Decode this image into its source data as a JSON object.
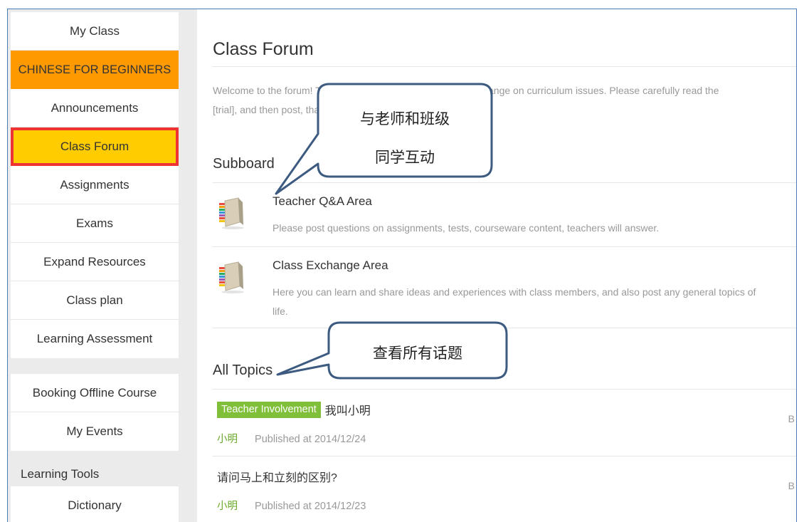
{
  "sidebar": {
    "group1": [
      {
        "label": "My Class"
      },
      {
        "label": "CHINESE FOR BEGINNERS"
      },
      {
        "label": "Announcements"
      },
      {
        "label": "Class Forum"
      },
      {
        "label": "Assignments"
      },
      {
        "label": "Exams"
      },
      {
        "label": "Expand Resources"
      },
      {
        "label": "Class plan"
      },
      {
        "label": "Learning Assessment"
      }
    ],
    "group2": [
      {
        "label": "Booking Offline Course"
      },
      {
        "label": "My Events"
      }
    ],
    "tools_label": "Learning Tools",
    "tools": [
      {
        "label": "Dictionary"
      }
    ]
  },
  "main": {
    "title": "Class Forum",
    "welcome_line1": "Welcome to the forum! The forum is used for everyone to exchange on curriculum issues. Please carefully read the",
    "welcome_line2": "[trial], and then post, thank you!",
    "subboard_title": "Subboard",
    "boards": [
      {
        "name": "Teacher Q&A Area",
        "desc_line1": "Please post questions on assignments, tests, courseware content, teachers will answer.",
        "desc_line2": "",
        "icon": "book-icon"
      },
      {
        "name": "Class Exchange Area",
        "desc_line1": "Here you can learn and share ideas and experiences with class members, and also post any general topics of",
        "desc_line2": "life.",
        "icon": "book-icon"
      }
    ],
    "all_topics_title": "All Topics",
    "topics": [
      {
        "tag": "Teacher Involvement",
        "title": "我叫小明",
        "author": "小明",
        "published": "Published at 2014/12/24",
        "by": "B"
      },
      {
        "tag": "",
        "title": "请问马上和立刻的区别?",
        "author": "小明",
        "published": "Published at 2014/12/23",
        "by": "B"
      }
    ]
  },
  "callouts": {
    "c1_line1": "与老师和班级",
    "c1_line2": "同学互动",
    "c2": "查看所有话题"
  },
  "colors": {
    "course_bg": "#ff9900",
    "active_bg": "#ffcc00",
    "active_border": "#ee3333",
    "tag_bg": "#7fbf3a",
    "frame_border": "#4a7ab8",
    "callout_border": "#3d5a80"
  }
}
